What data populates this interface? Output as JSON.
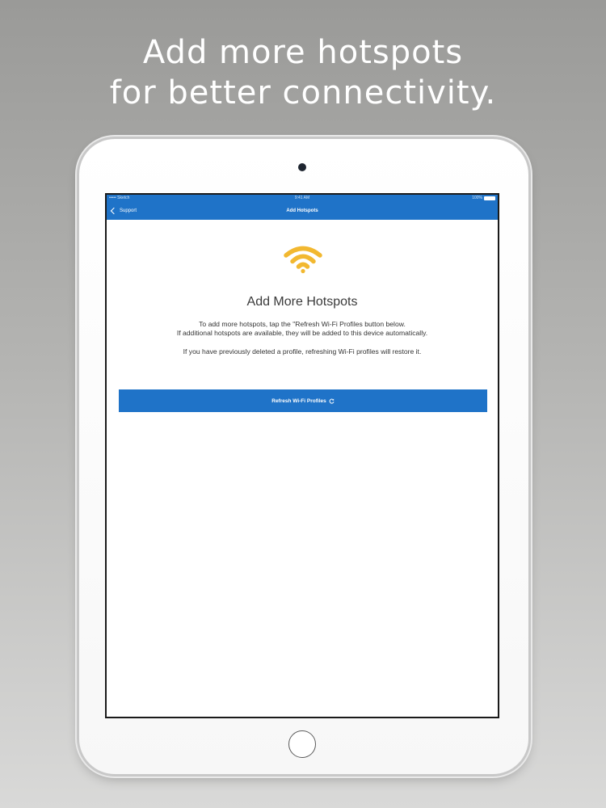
{
  "headline": {
    "line1": "Add more hotspots",
    "line2": "for better connectivity."
  },
  "status_bar": {
    "carrier": "••••• Sketch",
    "time": "9:41 AM",
    "battery": "100%"
  },
  "nav": {
    "back_label": "Support",
    "title": "Add Hotspots"
  },
  "content": {
    "icon": "wifi-icon",
    "title": "Add More Hotspots",
    "para1_line1": "To add more hotspots, tap the \"Refresh Wi-Fi Profiles button below.",
    "para1_line2": "If additional hotspots are available, they will be added to this device automatically.",
    "para2": "If you have previously deleted a profile, refreshing Wi-Fi profiles will restore it.",
    "button_label": "Refresh Wi-Fi Profiles",
    "button_icon": "refresh-icon"
  },
  "colors": {
    "accent": "#1f73c8",
    "wifi_icon": "#f2b830",
    "background_top": "#9a9a98",
    "background_bottom": "#d9d9d8"
  }
}
